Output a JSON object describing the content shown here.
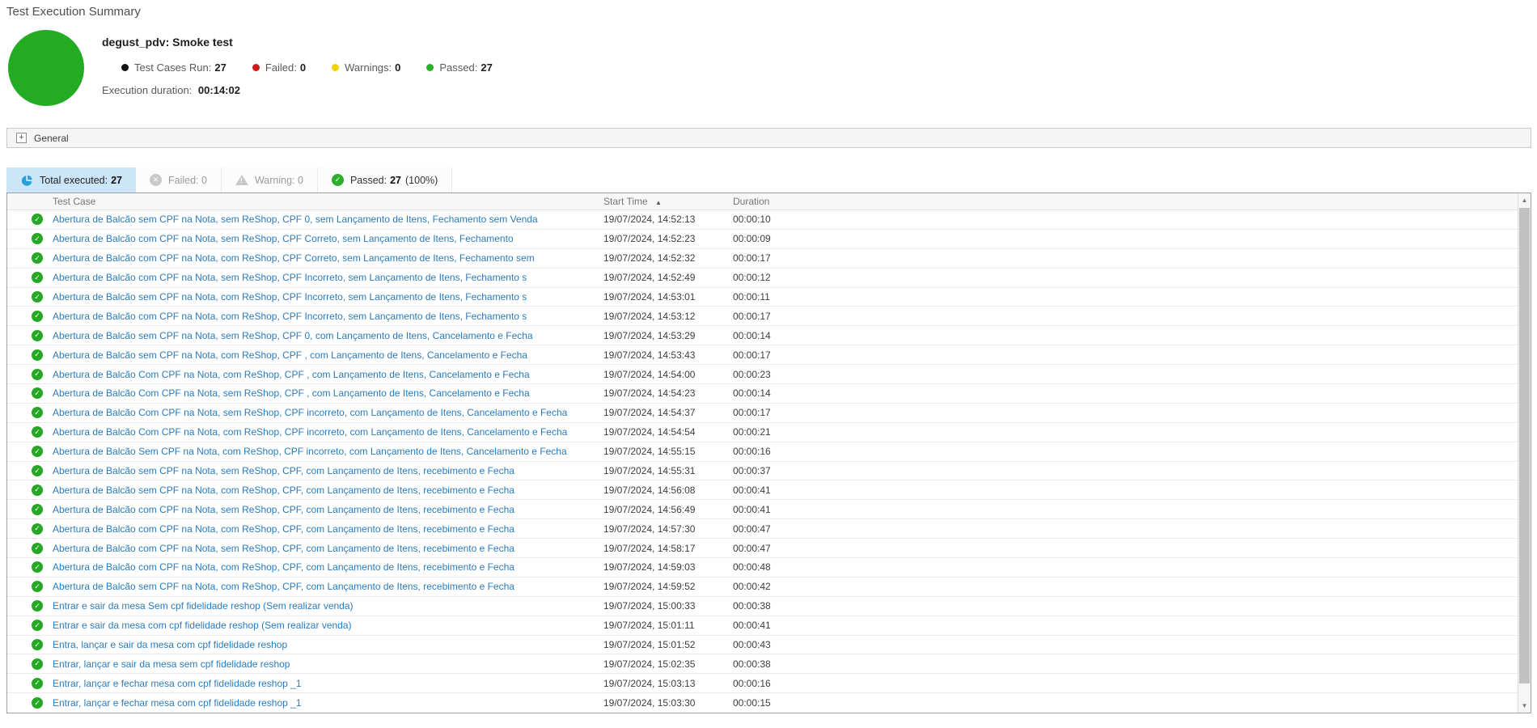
{
  "page_title": "Test Execution Summary",
  "summary": {
    "suite_title": "degust_pdv: Smoke test",
    "pie_color": "#23ab23",
    "stats": [
      {
        "label": "Test Cases Run:",
        "value": "27",
        "dot_color": "#111111"
      },
      {
        "label": "Failed:",
        "value": "0",
        "dot_color": "#d11a1a"
      },
      {
        "label": "Warnings:",
        "value": "0",
        "dot_color": "#f0d400"
      },
      {
        "label": "Passed:",
        "value": "27",
        "dot_color": "#27b227"
      }
    ],
    "duration_label": "Execution duration:",
    "duration_value": "00:14:02"
  },
  "general": {
    "label": "General",
    "expand_symbol": "+"
  },
  "tabs": {
    "total": {
      "label": "Total executed:",
      "value": "27",
      "icon_color": "#2b9fd8"
    },
    "failed": {
      "label": "Failed: 0",
      "icon_color": "#c9c9c9",
      "icon_glyph": "✕"
    },
    "warning": {
      "label": "Warning: 0",
      "icon_color": "#c9c9c9"
    },
    "passed": {
      "label": "Passed:",
      "value": "27",
      "suffix": "(100%)",
      "icon_color": "#2eae2e",
      "icon_glyph": "✓"
    }
  },
  "table": {
    "columns": {
      "test_case": "Test Case",
      "start_time": "Start Time",
      "duration": "Duration"
    },
    "sort_icon": "▲",
    "row_status_glyph": "✓",
    "rows": [
      {
        "name": "Abertura de Balcão sem CPF na Nota, sem ReShop, CPF 0, sem Lançamento de Itens, Fechamento sem Venda",
        "start": "19/07/2024, 14:52:13",
        "duration": "00:00:10"
      },
      {
        "name": "Abertura de Balcão com CPF na Nota, sem ReShop, CPF Correto, sem Lançamento de Itens, Fechamento",
        "start": "19/07/2024, 14:52:23",
        "duration": "00:00:09"
      },
      {
        "name": "Abertura de Balcão com CPF na Nota, com ReShop, CPF Correto, sem Lançamento de Itens, Fechamento sem",
        "start": "19/07/2024, 14:52:32",
        "duration": "00:00:17"
      },
      {
        "name": "Abertura de Balcão com CPF na Nota, sem ReShop, CPF Incorreto, sem Lançamento de Itens, Fechamento s",
        "start": "19/07/2024, 14:52:49",
        "duration": "00:00:12"
      },
      {
        "name": "Abertura de Balcão sem CPF na Nota, com ReShop, CPF Incorreto, sem Lançamento de Itens, Fechamento s",
        "start": "19/07/2024, 14:53:01",
        "duration": "00:00:11"
      },
      {
        "name": "Abertura de Balcão com CPF na Nota, com ReShop, CPF Incorreto, sem Lançamento de Itens, Fechamento s",
        "start": "19/07/2024, 14:53:12",
        "duration": "00:00:17"
      },
      {
        "name": "Abertura de Balcão sem CPF na Nota, sem ReShop, CPF 0, com Lançamento de Itens, Cancelamento e Fecha",
        "start": "19/07/2024, 14:53:29",
        "duration": "00:00:14"
      },
      {
        "name": "Abertura de Balcão sem CPF na Nota, com ReShop, CPF , com Lançamento de Itens, Cancelamento e Fecha",
        "start": "19/07/2024, 14:53:43",
        "duration": "00:00:17"
      },
      {
        "name": "Abertura de Balcão Com CPF na Nota, com ReShop, CPF , com Lançamento de Itens, Cancelamento e Fecha",
        "start": "19/07/2024, 14:54:00",
        "duration": "00:00:23"
      },
      {
        "name": "Abertura de Balcão Com CPF na Nota, sem ReShop, CPF , com Lançamento de Itens, Cancelamento e Fecha",
        "start": "19/07/2024, 14:54:23",
        "duration": "00:00:14"
      },
      {
        "name": "Abertura de Balcão Com CPF na Nota, sem ReShop, CPF incorreto, com Lançamento de Itens, Cancelamento e Fecha",
        "start": "19/07/2024, 14:54:37",
        "duration": "00:00:17"
      },
      {
        "name": "Abertura de Balcão Com CPF na Nota, com ReShop, CPF incorreto, com Lançamento de Itens, Cancelamento e Fecha",
        "start": "19/07/2024, 14:54:54",
        "duration": "00:00:21"
      },
      {
        "name": "Abertura de Balcão Sem CPF na Nota, com ReShop, CPF incorreto, com Lançamento de Itens, Cancelamento e Fecha",
        "start": "19/07/2024, 14:55:15",
        "duration": "00:00:16"
      },
      {
        "name": "Abertura de Balcão sem CPF na Nota, sem ReShop, CPF, com Lançamento de Itens, recebimento e Fecha",
        "start": "19/07/2024, 14:55:31",
        "duration": "00:00:37"
      },
      {
        "name": "Abertura de Balcão sem CPF na Nota, com ReShop, CPF, com Lançamento de Itens, recebimento e Fecha",
        "start": "19/07/2024, 14:56:08",
        "duration": "00:00:41"
      },
      {
        "name": "Abertura de Balcão com CPF na Nota, sem ReShop, CPF, com Lançamento de Itens, recebimento e Fecha",
        "start": "19/07/2024, 14:56:49",
        "duration": "00:00:41"
      },
      {
        "name": "Abertura de Balcão com CPF na Nota, com ReShop, CPF, com Lançamento de Itens, recebimento e Fecha",
        "start": "19/07/2024, 14:57:30",
        "duration": "00:00:47"
      },
      {
        "name": "Abertura de Balcão com CPF na Nota, sem ReShop, CPF, com Lançamento de Itens, recebimento e Fecha",
        "start": "19/07/2024, 14:58:17",
        "duration": "00:00:47"
      },
      {
        "name": "Abertura de Balcão com CPF na Nota, com ReShop, CPF, com Lançamento de Itens, recebimento e Fecha",
        "start": "19/07/2024, 14:59:03",
        "duration": "00:00:48"
      },
      {
        "name": "Abertura de Balcão sem CPF na Nota, com ReShop, CPF, com Lançamento de Itens, recebimento e Fecha",
        "start": "19/07/2024, 14:59:52",
        "duration": "00:00:42"
      },
      {
        "name": "Entrar e sair da mesa Sem cpf fidelidade reshop (Sem realizar venda)",
        "start": "19/07/2024, 15:00:33",
        "duration": "00:00:38"
      },
      {
        "name": "Entrar e sair da mesa com cpf fidelidade reshop (Sem realizar venda)",
        "start": "19/07/2024, 15:01:11",
        "duration": "00:00:41"
      },
      {
        "name": "Entra, lançar e sair da mesa com cpf fidelidade reshop",
        "start": "19/07/2024, 15:01:52",
        "duration": "00:00:43"
      },
      {
        "name": "Entrar, lançar e sair da mesa sem cpf fidelidade reshop",
        "start": "19/07/2024, 15:02:35",
        "duration": "00:00:38"
      },
      {
        "name": "Entrar, lançar e fechar mesa com cpf fidelidade reshop _1",
        "start": "19/07/2024, 15:03:13",
        "duration": "00:00:16"
      },
      {
        "name": "Entrar, lançar e fechar mesa com cpf fidelidade reshop _1",
        "start": "19/07/2024, 15:03:30",
        "duration": "00:00:15"
      }
    ]
  },
  "scrollbar": {
    "up_glyph": "▲",
    "down_glyph": "▼"
  }
}
